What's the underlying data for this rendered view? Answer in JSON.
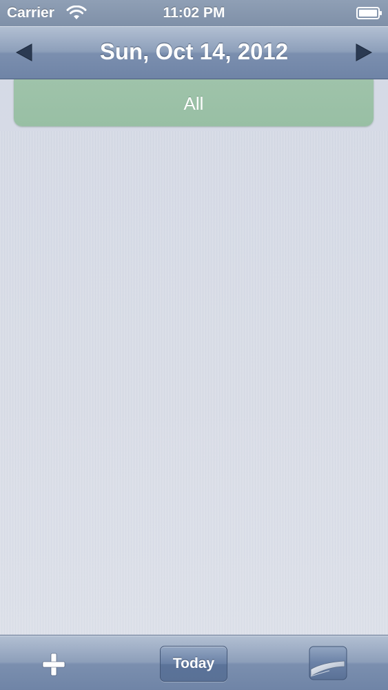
{
  "status_bar": {
    "carrier": "Carrier",
    "time": "11:02 PM",
    "icons": [
      "wifi-icon",
      "battery-icon"
    ]
  },
  "nav_bar": {
    "title": "Sun, Oct 14, 2012",
    "prev_icon": "left-triangle-arrow-icon",
    "next_icon": "right-triangle-arrow-icon"
  },
  "filter": {
    "label": "All",
    "color": "#9fc3aa"
  },
  "toolbar": {
    "add_icon": "plus-icon",
    "today_label": "Today",
    "page_curl_icon": "page-curl-icon"
  },
  "colors": {
    "bar_tint": "#7b8faf",
    "background": "#d9dde7",
    "filter_green": "#9fc3aa"
  }
}
